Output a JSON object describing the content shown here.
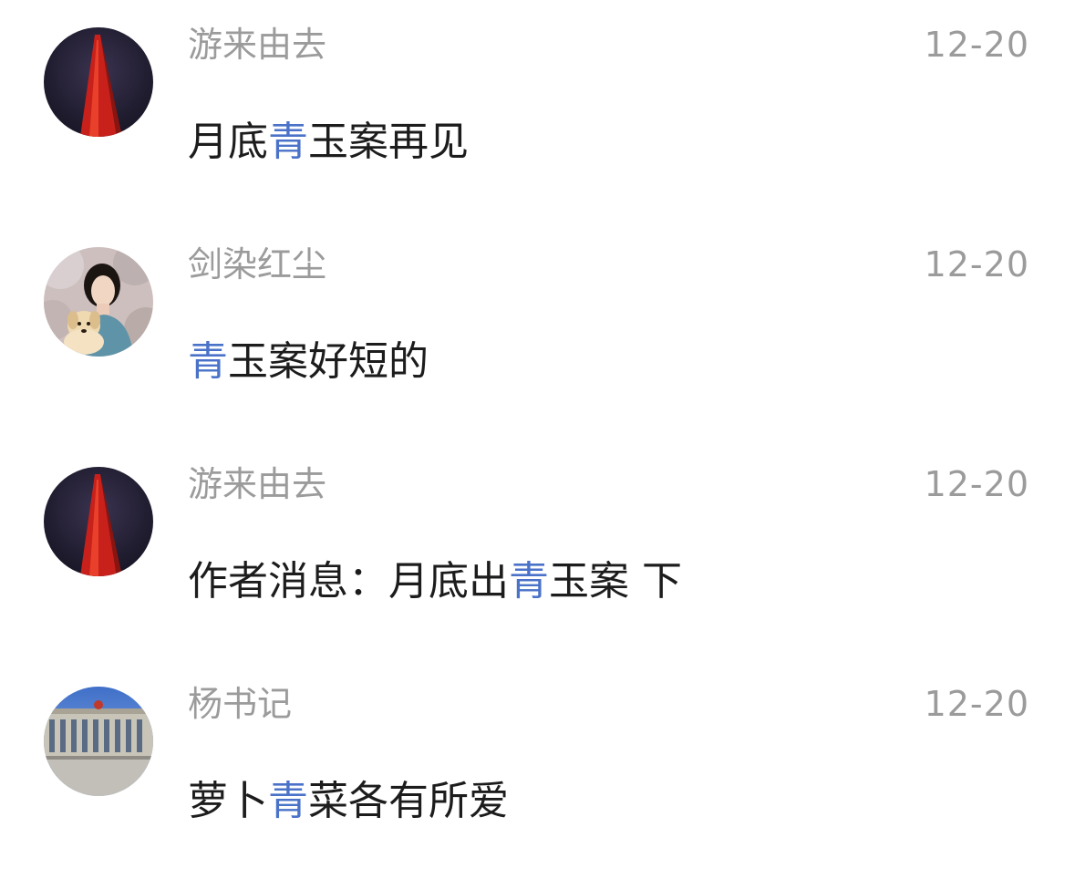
{
  "comments": [
    {
      "username": "游来由去",
      "date": "12-20",
      "text_before": "月底",
      "highlight": "青",
      "text_after": "玉案再见",
      "avatar": "red-tower-night-avatar"
    },
    {
      "username": "剑染红尘",
      "date": "12-20",
      "text_before": "",
      "highlight": "青",
      "text_after": "玉案好短的",
      "avatar": "girl-with-puppy-avatar"
    },
    {
      "username": "游来由去",
      "date": "12-20",
      "text_before": "作者消息：月底出",
      "highlight": "青",
      "text_after": "玉案 下",
      "avatar": "red-tower-night-avatar"
    },
    {
      "username": "杨书记",
      "date": "12-20",
      "text_before": "萝卜",
      "highlight": "青",
      "text_after": "菜各有所爱",
      "avatar": "great-hall-building-avatar"
    }
  ],
  "colors": {
    "highlight": "#4a72c8",
    "meta": "#9b9b9b",
    "text": "#1c1c1c"
  }
}
